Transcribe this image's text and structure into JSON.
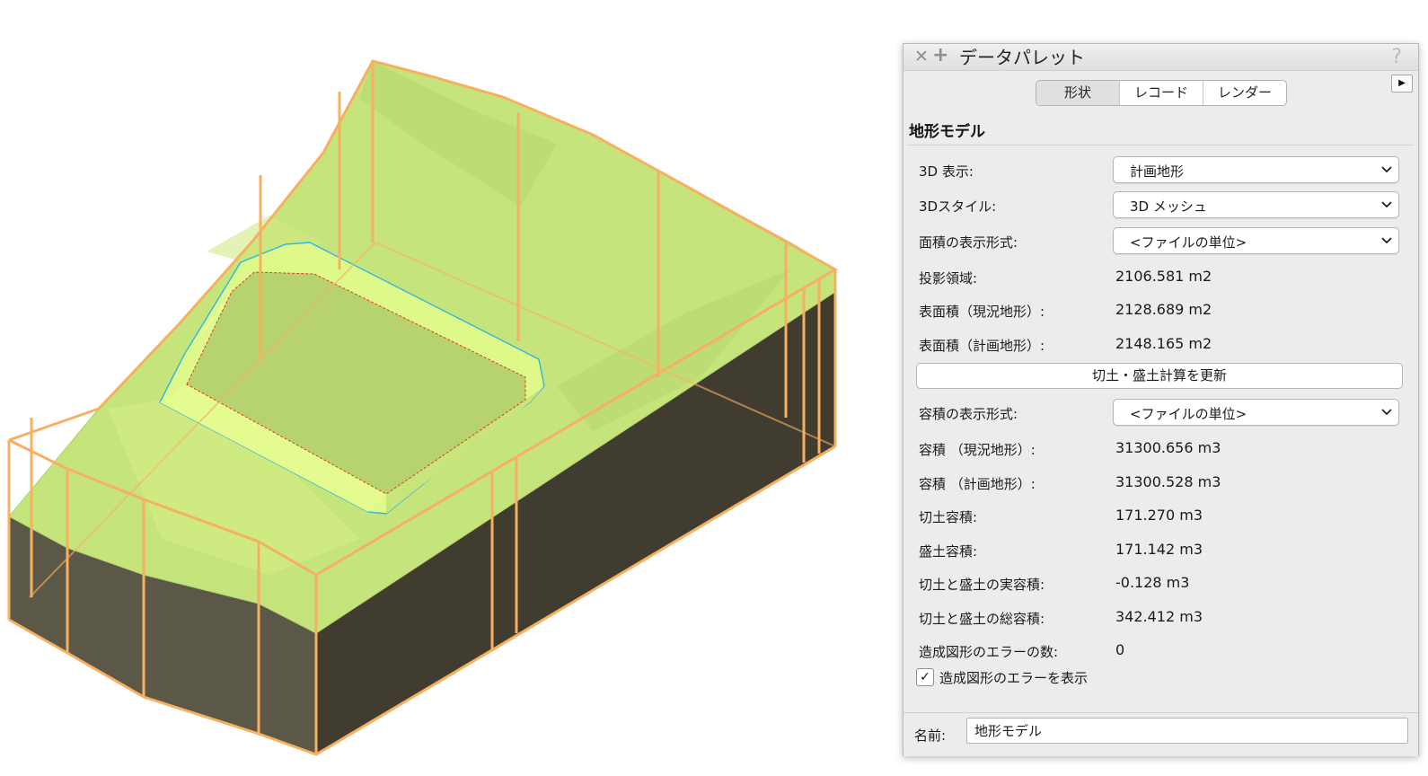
{
  "palette": {
    "title": "データパレット",
    "close_icon": "close-icon",
    "add_icon": "plus-icon",
    "help_glyph": "?",
    "tabs": [
      {
        "label": "形状"
      },
      {
        "label": "レコード"
      },
      {
        "label": "レンダー"
      }
    ],
    "active_tab": "形状",
    "section_title": "地形モデル",
    "fields": {
      "display3d": {
        "label": "3D 表示:",
        "value": "計画地形"
      },
      "style3d": {
        "label": "3Dスタイル:",
        "value": "3D メッシュ"
      },
      "area_format": {
        "label": "面積の表示形式:",
        "value": "<ファイルの単位>"
      },
      "projected_area": {
        "label": "投影領域:",
        "value": "2106.581  m2"
      },
      "surface_existing": {
        "label": "表面積（現況地形）:",
        "value": "2128.689  m2"
      },
      "surface_proposed": {
        "label": "表面積（計画地形）:",
        "value": "2148.165  m2"
      },
      "update_button": "切土・盛土計算を更新",
      "volume_format": {
        "label": "容積の表示形式:",
        "value": "<ファイルの単位>"
      },
      "volume_existing": {
        "label": "容積 （現況地形）:",
        "value": "31300.656  m3"
      },
      "volume_proposed": {
        "label": "容積 （計画地形）:",
        "value": "31300.528  m3"
      },
      "cut_volume": {
        "label": "切土容積:",
        "value": "171.270  m3"
      },
      "fill_volume": {
        "label": "盛土容積:",
        "value": "171.142  m3"
      },
      "net_volume": {
        "label": "切土と盛土の実容積:",
        "value": "-0.128  m3"
      },
      "total_volume": {
        "label": "切土と盛土の総容積:",
        "value": "342.412  m3"
      },
      "error_count": {
        "label": "造成図形のエラーの数:",
        "value": "0"
      },
      "show_errors": {
        "label": "造成図形のエラーを表示",
        "checked": true,
        "mark": "✓"
      }
    },
    "name": {
      "label": "名前:",
      "value": "地形モデル"
    }
  },
  "colors": {
    "terrain_green": "#c4e27a",
    "pad_green": "#d8f47c",
    "side_dark": "#4a4638",
    "frame_orange": "#f6b060"
  }
}
